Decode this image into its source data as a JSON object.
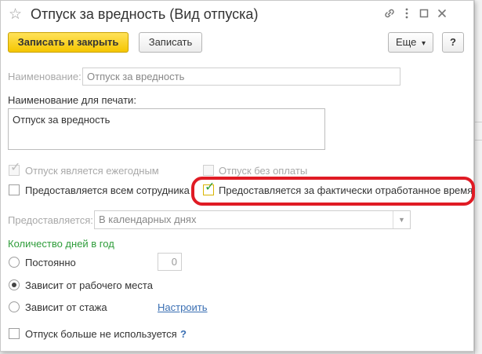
{
  "window": {
    "title": "Отпуск за вредность (Вид отпуска)",
    "icons": [
      "star-icon",
      "link-icon",
      "more-icon",
      "maximize-icon",
      "close-icon"
    ]
  },
  "toolbar": {
    "save_close_label": "Записать и закрыть",
    "save_label": "Записать",
    "more_label": "Еще",
    "more_glyph": "▾",
    "help_label": "?"
  },
  "form": {
    "name_label": "Наименование:",
    "name_value": "Отпуск за вредность",
    "print_name_label": "Наименование для печати:",
    "print_name_value": "Отпуск за вредность",
    "checkboxes": {
      "annual": {
        "label": "Отпуск является ежегодным",
        "checked": true
      },
      "unpaid": {
        "label": "Отпуск без оплаты",
        "checked": false
      },
      "all_employees": {
        "label": "Предоставляется всем сотрудникам",
        "checked": false
      },
      "actual_time": {
        "label": "Предоставляется за фактически отработанное время",
        "checked": true
      }
    },
    "provided_label": "Предоставляется:",
    "provided_value": "В календарных днях",
    "days_section_label": "Количество дней в год",
    "radios": {
      "constant": {
        "label": "Постоянно",
        "selected": false
      },
      "workplace": {
        "label": "Зависит от рабочего места",
        "selected": true
      },
      "seniority": {
        "label": "Зависит от стажа",
        "selected": false
      }
    },
    "constant_days_value": "0",
    "configure_link": "Настроить",
    "not_used": {
      "label": "Отпуск больше не используется",
      "checked": false
    },
    "not_used_help": "?"
  },
  "colors": {
    "accent_yellow": "#f5c600",
    "section_green": "#2e9d3a",
    "highlight_red": "#e01b24",
    "link_blue": "#3a6fb3"
  }
}
